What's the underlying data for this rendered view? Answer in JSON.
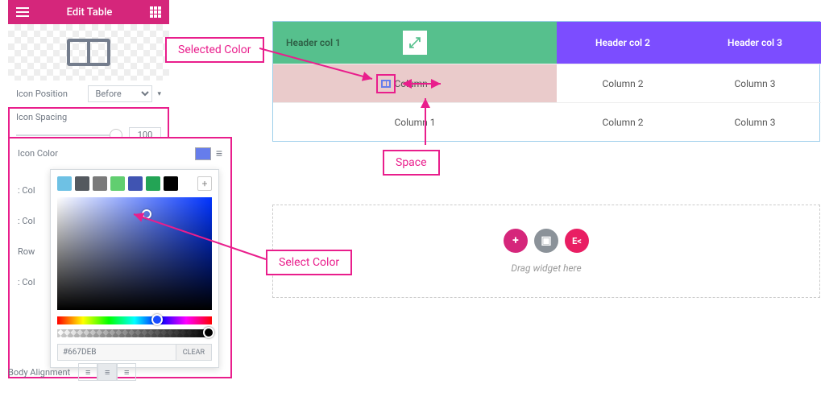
{
  "header": {
    "title": "Edit Table"
  },
  "controls": {
    "icon_position_label": "Icon Position",
    "icon_position_value": "Before",
    "icon_spacing_label": "Icon Spacing",
    "icon_spacing_value": "100",
    "icon_color_label": "Icon Color",
    "body_alignment_label": "Body Alignment",
    "side_labels": {
      "col1": ": Col",
      "col2": ": Col",
      "row": "Row",
      "col3": ": Col"
    }
  },
  "color_picker": {
    "hex": "#667DEB",
    "clear_label": "CLEAR",
    "presets": [
      "#6ec1e4",
      "#54595f",
      "#7a7a7a",
      "#61ce70",
      "#4054b2",
      "#23a455",
      "#000000"
    ]
  },
  "table": {
    "headers": [
      "Header col 1",
      "Header col 2",
      "Header col 3"
    ],
    "rows": [
      [
        "Column 1",
        "Column 2",
        "Column 3"
      ],
      [
        "Column 1",
        "Column 2",
        "Column 3"
      ]
    ]
  },
  "drop_zone": {
    "hint": "Drag widget here",
    "ek": "E<"
  },
  "annotations": {
    "selected_color": "Selected Color",
    "space": "Space",
    "select_color": "Select Color"
  }
}
